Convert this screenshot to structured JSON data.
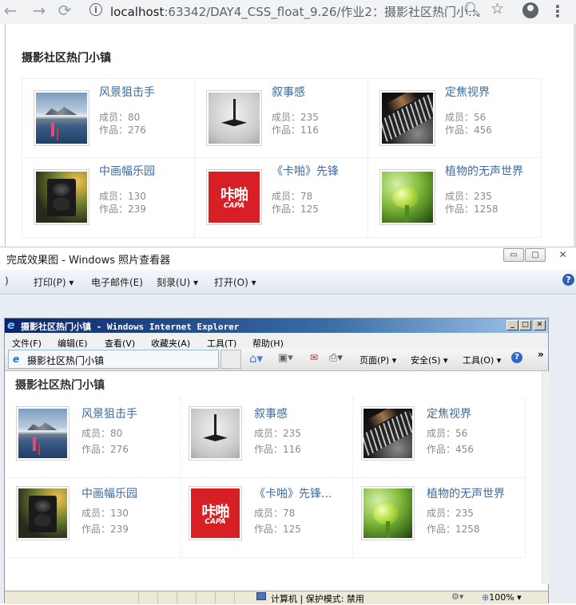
{
  "browser": {
    "url_host": "localhost",
    "url_rest": ":63342/DAY4_CSS_float_9.26/作业2：摄影社区热门小...",
    "icons": [
      "back-icon",
      "forward-icon",
      "reload-icon",
      "info-icon",
      "zoom-icon",
      "star-icon",
      "profile-icon",
      "menu-icon"
    ]
  },
  "page": {
    "title": "摄影社区热门小镇",
    "member_label": "成员：",
    "works_label": "作品：",
    "cards": [
      {
        "name": "风景狙击手",
        "members": "80",
        "works": "276",
        "image": "sniper"
      },
      {
        "name": "叙事感",
        "members": "235",
        "works": "116",
        "image": "top"
      },
      {
        "name": "定焦视界",
        "members": "56",
        "works": "456",
        "image": "lens"
      },
      {
        "name": "中画幅乐园",
        "members": "130",
        "works": "239",
        "image": "camera"
      },
      {
        "name": "《卡啪》先锋",
        "members": "78",
        "works": "125",
        "image": "kapa"
      },
      {
        "name": "植物的无声世界",
        "members": "235",
        "works": "1258",
        "image": "sprout"
      }
    ]
  },
  "viewer": {
    "title": "完成效果图 - Windows 照片查看器",
    "menu": {
      "first": ")",
      "print": "打印(P)",
      "email": "电子邮件(E)",
      "burn": "刻录(U)",
      "open": "打开(O)"
    },
    "buttons": {
      "min": "▭",
      "max": "▢",
      "close": "✕"
    }
  },
  "ie": {
    "window_title": "摄影社区热门小镇 - Windows Internet Explorer",
    "menu": {
      "file": "文件(F)",
      "edit": "编辑(E)",
      "view": "查看(V)",
      "favorites": "收藏夹(A)",
      "tools": "工具(T)",
      "help": "帮助(H)"
    },
    "tab_title": "摄影社区热门小镇",
    "commands": {
      "page": "页面(P) ▾",
      "safety": "安全(S) ▾",
      "tools": "工具(O) ▾",
      "more": "»"
    },
    "page": {
      "title": "摄影社区热门小镇",
      "member_label": "成员：",
      "works_label": "作品：",
      "cards": [
        {
          "name": "风景狙击手",
          "members": "80",
          "works": "276",
          "image": "sniper"
        },
        {
          "name": "叙事感",
          "members": "235",
          "works": "116",
          "image": "top"
        },
        {
          "name": "定焦视界",
          "members": "56",
          "works": "456",
          "image": "lens"
        },
        {
          "name": "中画幅乐园",
          "members": "130",
          "works": "239",
          "image": "camera"
        },
        {
          "name": "《卡啪》先锋...",
          "members": "78",
          "works": "125",
          "image": "kapa"
        },
        {
          "name": "植物的无声世界",
          "members": "235",
          "works": "1258",
          "image": "sprout"
        }
      ]
    },
    "status": {
      "zone": "计算机 | 保护模式: 禁用",
      "zoom": "100%"
    }
  },
  "kapa_logo": {
    "main": "咔啪",
    "sub": "CAPA"
  }
}
